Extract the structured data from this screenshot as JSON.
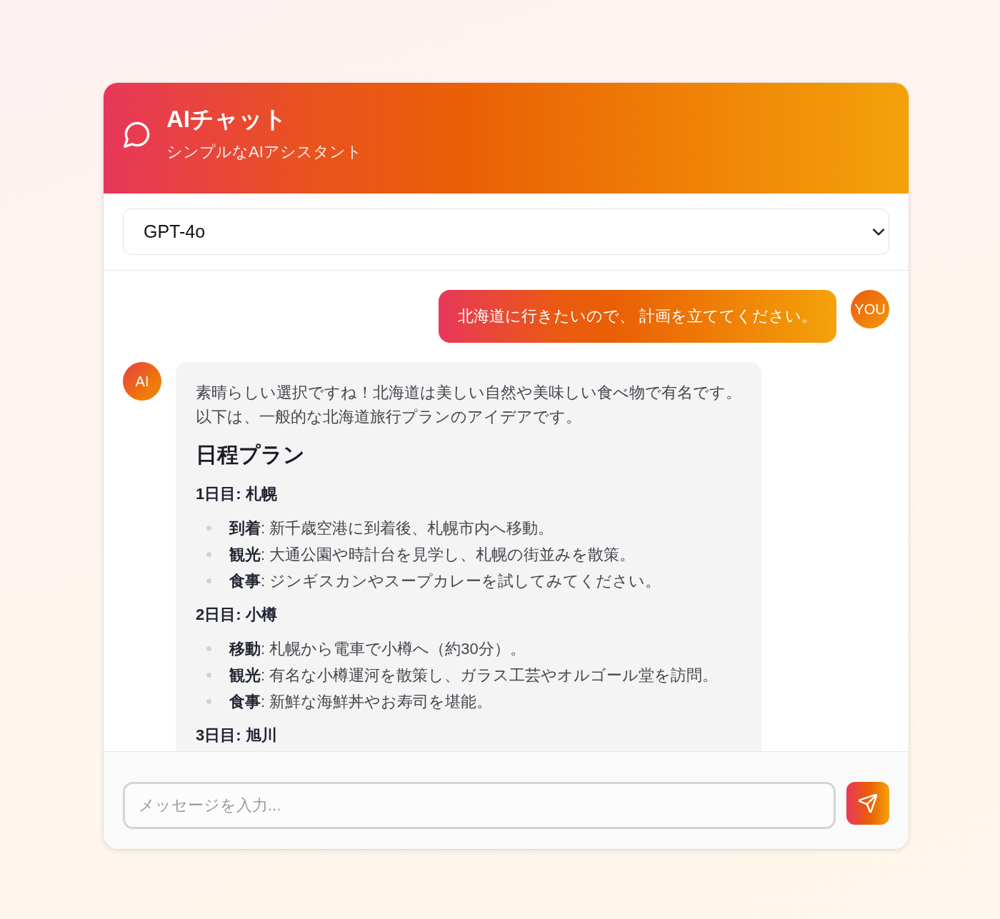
{
  "header": {
    "title": "AIチャット",
    "subtitle": "シンプルなAIアシスタント"
  },
  "model_select": {
    "value": "GPT-4o"
  },
  "messages": [
    {
      "kind": "user",
      "avatar": "YOU",
      "text": "北海道に行きたいので、 計画を立ててください。"
    },
    {
      "kind": "assistant",
      "avatar": "AI",
      "blocks": [
        {
          "kind": "paragraph",
          "lines": [
            "素晴らしい選択ですね！北海道は美しい自然や美味しい食べ物で有名です。",
            "以下は、一般的な北海道旅行プランのアイデアです。"
          ]
        },
        {
          "kind": "heading",
          "text": "日程プラン"
        },
        {
          "kind": "subheading",
          "text": "1日目: 札幌"
        },
        {
          "kind": "list",
          "items": [
            "**到着**: 新千歳空港に到着後、札幌市内へ移動。",
            "**観光**: 大通公園や時計台を見学し、札幌の街並みを散策。",
            "**食事**: ジンギスカンやスープカレーを試してみてください。"
          ]
        },
        {
          "kind": "subheading",
          "text": "2日目: 小樽"
        },
        {
          "kind": "list",
          "items": [
            "**移動**: 札幌から電車で小樽へ（約30分）。",
            "**観光**: 有名な小樽運河を散策し、ガラス工芸やオルゴール堂を訪問。",
            "**食事**: 新鮮な海鮮丼やお寿司を堪能。"
          ]
        },
        {
          "kind": "subheading",
          "text": "3日目: 旭川"
        }
      ]
    }
  ],
  "composer": {
    "placeholder": "メッセージを入力..."
  }
}
